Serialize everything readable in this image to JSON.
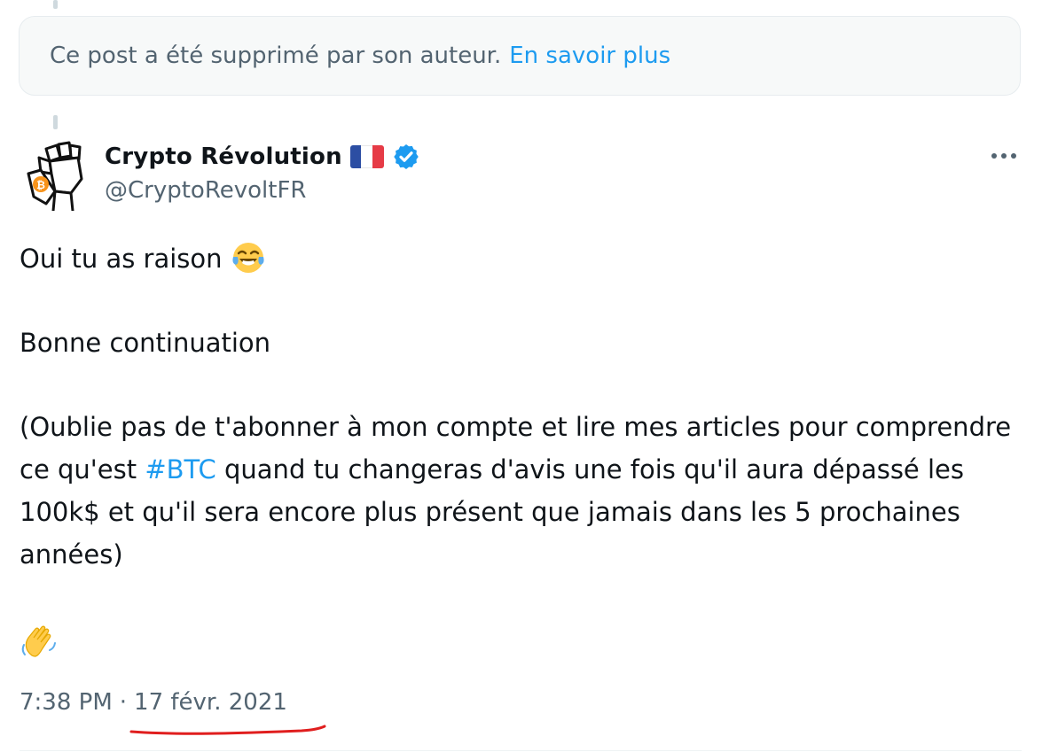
{
  "deleted_notice": {
    "text": "Ce post a été supprimé par son auteur.",
    "link": "En savoir plus"
  },
  "author": {
    "display_name": "Crypto Révolution",
    "handle": "@CryptoRevoltFR",
    "flag_icon": "france-flag-icon",
    "verified_icon": "verified-badge-icon",
    "avatar_icon": "raised-fist-bitcoin-logo",
    "colors": {
      "verified": "#1d9bf0",
      "link": "#1d9bf0",
      "muted": "#536471"
    }
  },
  "tweet": {
    "line1": "Oui tu as raison",
    "line1_emoji": "face-with-tears-of-joy-icon",
    "line2": "Bonne continuation",
    "para3_before": "(Oublie pas de t'abonner à mon compte et lire mes articles pour comprendre ce qu'est",
    "hashtag": "#BTC",
    "para3_after": "quand tu changeras d'avis une fois qu'il aura dépassé les 100k$ et qu'il sera encore plus présent que jamais dans les 5 prochaines années)",
    "closing_emoji": "waving-hand-icon"
  },
  "meta": {
    "time": "7:38 PM",
    "separator": "·",
    "date": "17 févr. 2021"
  }
}
